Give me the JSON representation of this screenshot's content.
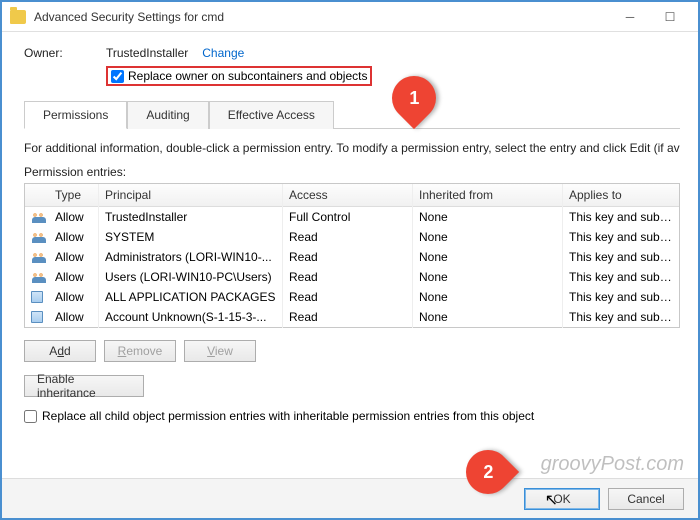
{
  "titlebar": {
    "text": "Advanced Security Settings for cmd"
  },
  "owner": {
    "label": "Owner:",
    "value": "TrustedInstaller",
    "change": "Change",
    "replace_label": "Replace owner on subcontainers and objects",
    "replace_checked": true
  },
  "tabs": {
    "permissions": "Permissions",
    "auditing": "Auditing",
    "effective": "Effective Access"
  },
  "info": "For additional information, double-click a permission entry. To modify a permission entry, select the entry and click Edit (if availa",
  "entries_label": "Permission entries:",
  "columns": {
    "type": "Type",
    "principal": "Principal",
    "access": "Access",
    "inherited": "Inherited from",
    "applies": "Applies to"
  },
  "rows": [
    {
      "icon": "group",
      "type": "Allow",
      "principal": "TrustedInstaller",
      "access": "Full Control",
      "inherited": "None",
      "applies": "This key and subkeys"
    },
    {
      "icon": "group",
      "type": "Allow",
      "principal": "SYSTEM",
      "access": "Read",
      "inherited": "None",
      "applies": "This key and subkeys"
    },
    {
      "icon": "group",
      "type": "Allow",
      "principal": "Administrators (LORI-WIN10-...",
      "access": "Read",
      "inherited": "None",
      "applies": "This key and subkeys"
    },
    {
      "icon": "group",
      "type": "Allow",
      "principal": "Users (LORI-WIN10-PC\\Users)",
      "access": "Read",
      "inherited": "None",
      "applies": "This key and subkeys"
    },
    {
      "icon": "app",
      "type": "Allow",
      "principal": "ALL APPLICATION PACKAGES",
      "access": "Read",
      "inherited": "None",
      "applies": "This key and subkeys"
    },
    {
      "icon": "app",
      "type": "Allow",
      "principal": "Account Unknown(S-1-15-3-...",
      "access": "Read",
      "inherited": "None",
      "applies": "This key and subkeys"
    }
  ],
  "buttons": {
    "add": "Add",
    "remove": "Remove",
    "view": "View",
    "enable_inheritance": "Enable inheritance",
    "replace_child": "Replace all child object permission entries with inheritable permission entries from this object",
    "ok": "OK",
    "cancel": "Cancel"
  },
  "callouts": {
    "one": "1",
    "two": "2"
  },
  "watermark": "groovyPost.com"
}
